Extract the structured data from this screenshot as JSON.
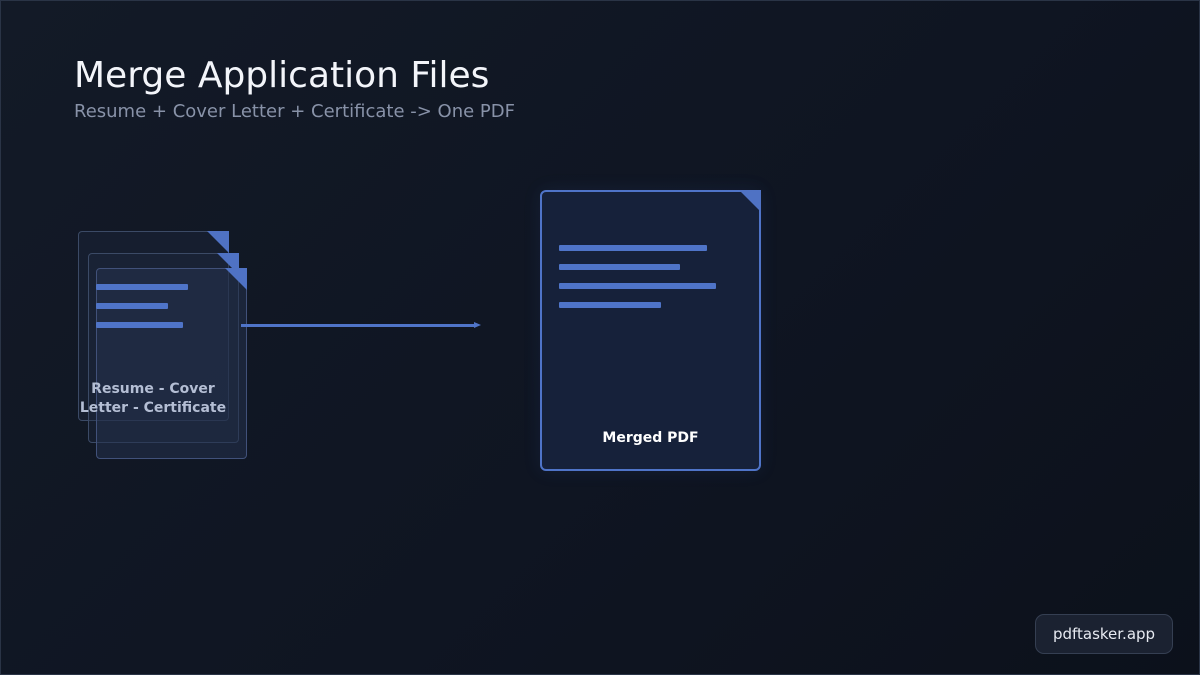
{
  "header": {
    "title": "Merge Application Files",
    "subtitle": "Resume + Cover Letter + Certificate -> One PDF"
  },
  "source_stack": {
    "label_line1": "Resume - Cover",
    "label_line2": "Letter - Certificate"
  },
  "merged_document": {
    "label": "Merged PDF"
  },
  "brand": {
    "label": "pdftasker.app"
  },
  "colors": {
    "accent": "#4f74c8",
    "background": "#0f1522",
    "subtitle": "#8892a8"
  },
  "icons": {
    "page_icon": "document-icon",
    "fold_icon": "page-fold-icon",
    "arrow_icon": "arrow-right-icon"
  }
}
